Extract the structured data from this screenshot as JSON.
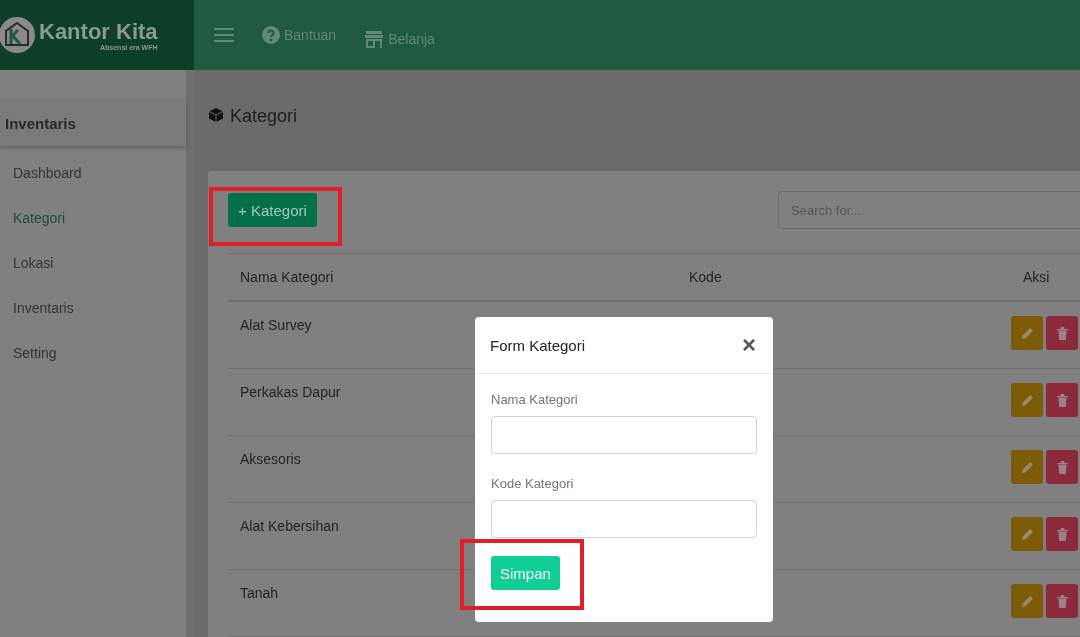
{
  "header": {
    "brand": "Kantor Kita",
    "tagline": "Absensi era WFH",
    "nav": [
      {
        "label": "Bantuan",
        "kind": "help"
      },
      {
        "label": "Belanja",
        "kind": "store"
      }
    ]
  },
  "sidebar": {
    "section": "Inventaris",
    "items": [
      {
        "label": "Dashboard",
        "selected": false
      },
      {
        "label": "Kategori",
        "selected": true
      },
      {
        "label": "Lokasi",
        "selected": false
      },
      {
        "label": "Inventaris",
        "selected": false
      },
      {
        "label": "Setting",
        "selected": false
      }
    ]
  },
  "page_title": "Kategori",
  "add_button": "+ Kategori",
  "search": {
    "placeholder": "Search for..."
  },
  "table": {
    "columns": [
      "Nama Kategori",
      "Kode",
      "Aksi"
    ],
    "rows": [
      {
        "name": "Alat Survey"
      },
      {
        "name": "Perkakas Dapur"
      },
      {
        "name": "Aksesoris"
      },
      {
        "name": "Alat Kebersihan"
      },
      {
        "name": "Tanah"
      }
    ]
  },
  "modal": {
    "title": "Form Kategori",
    "close": "×",
    "fields": [
      {
        "label": "Nama Kategori"
      },
      {
        "label": "Kode Kategori"
      }
    ],
    "submit": "Simpan"
  }
}
